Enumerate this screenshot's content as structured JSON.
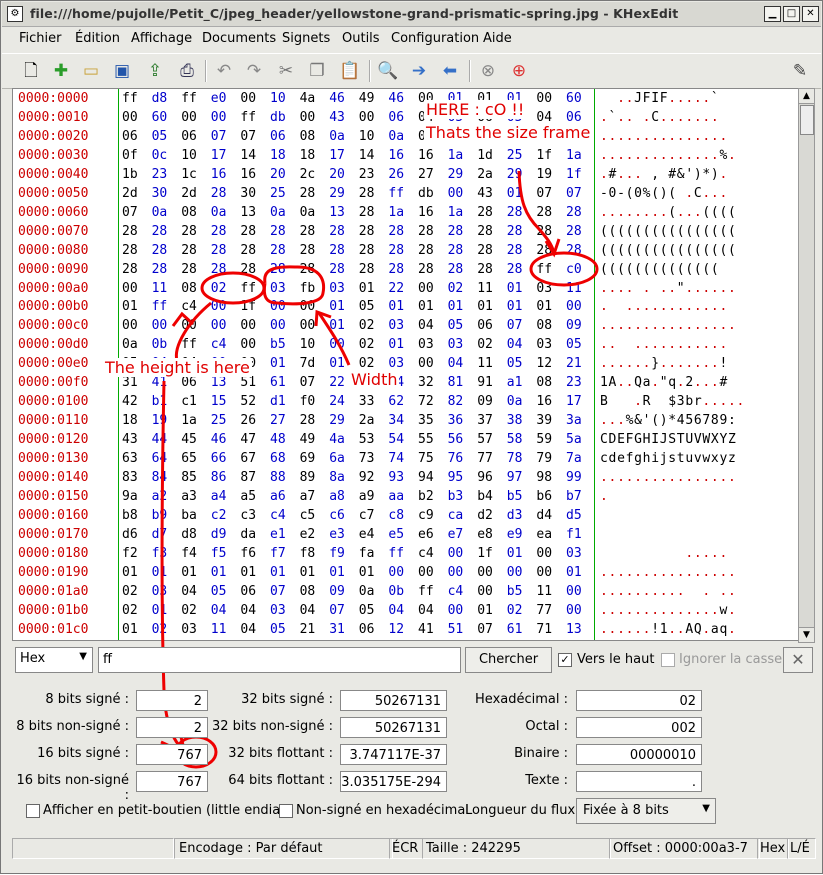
{
  "window": {
    "title": "file:///home/pujolle/Petit_C/jpeg_header/yellowstone-grand-prismatic-spring.jpg - KHexEdit"
  },
  "menu": [
    "Fichier",
    "Édition",
    "Affichage",
    "Documents",
    "Signets",
    "Outils",
    "Configuration",
    "Aide"
  ],
  "toolbar_icons": [
    "new-icon",
    "add-icon",
    "open-folder-icon",
    "save-icon",
    "export-icon",
    "print-icon",
    "undo-icon",
    "redo-icon",
    "copy-cut-icon",
    "copy-icon",
    "paste-icon",
    "find-icon",
    "next-icon",
    "previous-icon",
    "stop-icon",
    "help-icon",
    "edit-icon"
  ],
  "hex_rows": [
    {
      "addr": "0000:0000",
      "bytes": [
        "ff",
        "d8",
        "ff",
        "e0",
        "00",
        "10",
        "4a",
        "46",
        "49",
        "46",
        "00",
        "01",
        "01",
        "01",
        "00",
        "60"
      ],
      "ascii": "  ..JFIF.....`"
    },
    {
      "addr": "0000:0010",
      "bytes": [
        "00",
        "60",
        "00",
        "00",
        "ff",
        "db",
        "00",
        "43",
        "00",
        "06",
        "04",
        "05",
        "06",
        "05",
        "04",
        "06"
      ],
      "ascii": ".`.. .C......."
    },
    {
      "addr": "0000:0020",
      "bytes": [
        "06",
        "05",
        "06",
        "07",
        "07",
        "06",
        "08",
        "0a",
        "10",
        "0a",
        "0a",
        "09",
        "09",
        "0a",
        "14",
        "0e"
      ],
      "ascii": "..............."
    },
    {
      "addr": "0000:0030",
      "bytes": [
        "0f",
        "0c",
        "10",
        "17",
        "14",
        "18",
        "18",
        "17",
        "14",
        "16",
        "16",
        "1a",
        "1d",
        "25",
        "1f",
        "1a"
      ],
      "ascii": "..............%."
    },
    {
      "addr": "0000:0040",
      "bytes": [
        "1b",
        "23",
        "1c",
        "16",
        "16",
        "20",
        "2c",
        "20",
        "23",
        "26",
        "27",
        "29",
        "2a",
        "29",
        "19",
        "1f"
      ],
      "ascii": ".#... , #&')*)."
    },
    {
      "addr": "0000:0050",
      "bytes": [
        "2d",
        "30",
        "2d",
        "28",
        "30",
        "25",
        "28",
        "29",
        "28",
        "ff",
        "db",
        "00",
        "43",
        "01",
        "07",
        "07"
      ],
      "ascii": "-0-(0%()( .C..."
    },
    {
      "addr": "0000:0060",
      "bytes": [
        "07",
        "0a",
        "08",
        "0a",
        "13",
        "0a",
        "0a",
        "13",
        "28",
        "1a",
        "16",
        "1a",
        "28",
        "28",
        "28",
        "28"
      ],
      "ascii": "........(...(((("
    },
    {
      "addr": "0000:0070",
      "bytes": [
        "28",
        "28",
        "28",
        "28",
        "28",
        "28",
        "28",
        "28",
        "28",
        "28",
        "28",
        "28",
        "28",
        "28",
        "28",
        "28"
      ],
      "ascii": "(((((((((((((((("
    },
    {
      "addr": "0000:0080",
      "bytes": [
        "28",
        "28",
        "28",
        "28",
        "28",
        "28",
        "28",
        "28",
        "28",
        "28",
        "28",
        "28",
        "28",
        "28",
        "28",
        "28"
      ],
      "ascii": "(((((((((((((((("
    },
    {
      "addr": "0000:0090",
      "bytes": [
        "28",
        "28",
        "28",
        "28",
        "28",
        "28",
        "28",
        "28",
        "28",
        "28",
        "28",
        "28",
        "28",
        "28",
        "ff",
        "c0"
      ],
      "ascii": "((((((((((((((  "
    },
    {
      "addr": "0000:00a0",
      "bytes": [
        "00",
        "11",
        "08",
        "02",
        "ff",
        "03",
        "fb",
        "03",
        "01",
        "22",
        "00",
        "02",
        "11",
        "01",
        "03",
        "11"
      ],
      "ascii": ".... . ..\"......"
    },
    {
      "addr": "0000:00b0",
      "bytes": [
        "01",
        "ff",
        "c4",
        "00",
        "1f",
        "00",
        "00",
        "01",
        "05",
        "01",
        "01",
        "01",
        "01",
        "01",
        "01",
        "00"
      ],
      "ascii": ".  ............"
    },
    {
      "addr": "0000:00c0",
      "bytes": [
        "00",
        "00",
        "00",
        "00",
        "00",
        "00",
        "00",
        "01",
        "02",
        "03",
        "04",
        "05",
        "06",
        "07",
        "08",
        "09"
      ],
      "ascii": "................"
    },
    {
      "addr": "0000:00d0",
      "bytes": [
        "0a",
        "0b",
        "ff",
        "c4",
        "00",
        "b5",
        "10",
        "00",
        "02",
        "01",
        "03",
        "03",
        "02",
        "04",
        "03",
        "05"
      ],
      "ascii": "..  ..........."
    },
    {
      "addr": "0000:00e0",
      "bytes": [
        "05",
        "04",
        "04",
        "00",
        "00",
        "01",
        "7d",
        "01",
        "02",
        "03",
        "00",
        "04",
        "11",
        "05",
        "12",
        "21"
      ],
      "ascii": "......}.......!"
    },
    {
      "addr": "0000:00f0",
      "bytes": [
        "31",
        "41",
        "06",
        "13",
        "51",
        "61",
        "07",
        "22",
        "71",
        "14",
        "32",
        "81",
        "91",
        "a1",
        "08",
        "23"
      ],
      "ascii": "1A..Qa.\"q.2...#"
    },
    {
      "addr": "0000:0100",
      "bytes": [
        "42",
        "b1",
        "c1",
        "15",
        "52",
        "d1",
        "f0",
        "24",
        "33",
        "62",
        "72",
        "82",
        "09",
        "0a",
        "16",
        "17"
      ],
      "ascii": "B   .R  $3br....."
    },
    {
      "addr": "0000:0110",
      "bytes": [
        "18",
        "19",
        "1a",
        "25",
        "26",
        "27",
        "28",
        "29",
        "2a",
        "34",
        "35",
        "36",
        "37",
        "38",
        "39",
        "3a"
      ],
      "ascii": "...%&'()*456789:"
    },
    {
      "addr": "0000:0120",
      "bytes": [
        "43",
        "44",
        "45",
        "46",
        "47",
        "48",
        "49",
        "4a",
        "53",
        "54",
        "55",
        "56",
        "57",
        "58",
        "59",
        "5a"
      ],
      "ascii": "CDEFGHIJSTUVWXYZ"
    },
    {
      "addr": "0000:0130",
      "bytes": [
        "63",
        "64",
        "65",
        "66",
        "67",
        "68",
        "69",
        "6a",
        "73",
        "74",
        "75",
        "76",
        "77",
        "78",
        "79",
        "7a"
      ],
      "ascii": "cdefghijstuvwxyz"
    },
    {
      "addr": "0000:0140",
      "bytes": [
        "83",
        "84",
        "85",
        "86",
        "87",
        "88",
        "89",
        "8a",
        "92",
        "93",
        "94",
        "95",
        "96",
        "97",
        "98",
        "99"
      ],
      "ascii": "................"
    },
    {
      "addr": "0000:0150",
      "bytes": [
        "9a",
        "a2",
        "a3",
        "a4",
        "a5",
        "a6",
        "a7",
        "a8",
        "a9",
        "aa",
        "b2",
        "b3",
        "b4",
        "b5",
        "b6",
        "b7"
      ],
      "ascii": "."
    },
    {
      "addr": "0000:0160",
      "bytes": [
        "b8",
        "b9",
        "ba",
        "c2",
        "c3",
        "c4",
        "c5",
        "c6",
        "c7",
        "c8",
        "c9",
        "ca",
        "d2",
        "d3",
        "d4",
        "d5"
      ],
      "ascii": ""
    },
    {
      "addr": "0000:0170",
      "bytes": [
        "d6",
        "d7",
        "d8",
        "d9",
        "da",
        "e1",
        "e2",
        "e3",
        "e4",
        "e5",
        "e6",
        "e7",
        "e8",
        "e9",
        "ea",
        "f1"
      ],
      "ascii": ""
    },
    {
      "addr": "0000:0180",
      "bytes": [
        "f2",
        "f3",
        "f4",
        "f5",
        "f6",
        "f7",
        "f8",
        "f9",
        "fa",
        "ff",
        "c4",
        "00",
        "1f",
        "01",
        "00",
        "03"
      ],
      "ascii": "          ....."
    },
    {
      "addr": "0000:0190",
      "bytes": [
        "01",
        "01",
        "01",
        "01",
        "01",
        "01",
        "01",
        "01",
        "01",
        "00",
        "00",
        "00",
        "00",
        "00",
        "00",
        "01"
      ],
      "ascii": "................"
    },
    {
      "addr": "0000:01a0",
      "bytes": [
        "02",
        "03",
        "04",
        "05",
        "06",
        "07",
        "08",
        "09",
        "0a",
        "0b",
        "ff",
        "c4",
        "00",
        "b5",
        "11",
        "00"
      ],
      "ascii": "..........  . .."
    },
    {
      "addr": "0000:01b0",
      "bytes": [
        "02",
        "01",
        "02",
        "04",
        "04",
        "03",
        "04",
        "07",
        "05",
        "04",
        "04",
        "00",
        "01",
        "02",
        "77",
        "00"
      ],
      "ascii": "..............w."
    },
    {
      "addr": "0000:01c0",
      "bytes": [
        "01",
        "02",
        "03",
        "11",
        "04",
        "05",
        "21",
        "31",
        "06",
        "12",
        "41",
        "51",
        "07",
        "61",
        "71",
        "13"
      ],
      "ascii": "......!1..AQ.aq."
    }
  ],
  "annotations": {
    "here": "HERE : cO !!",
    "size_frame": "Thats the size frame",
    "height": "The height is here",
    "width": "Width"
  },
  "find": {
    "type_value": "Hex",
    "search_value": "ff",
    "search_button": "Chercher",
    "upward_label": "Vers le haut",
    "ignore_case_label": "Ignorer la casse",
    "close_glyph": "✕"
  },
  "conversion": {
    "s8_label": "8 bits signé :",
    "s8": "2",
    "u8_label": "8 bits non-signé :",
    "u8": "2",
    "s16_label": "16 bits signé :",
    "s16": "767",
    "u16_label": "16 bits non-signé :",
    "u16": "767",
    "s32_label": "32 bits signé :",
    "s32": "50267131",
    "u32_label": "32 bits non-signé :",
    "u32": "50267131",
    "f32_label": "32 bits flottant :",
    "f32": "3.747117E-37",
    "f64_label": "64 bits flottant :",
    "f64": "3.035175E-294",
    "hex_label": "Hexadécimal :",
    "hex": "02",
    "oct_label": "Octal :",
    "oct": "002",
    "bin_label": "Binaire :",
    "bin": "00000010",
    "text_label": "Texte :",
    "text": ".",
    "little_endian_label": "Afficher en petit-boutien (little endian)",
    "unsigned_hex_label": "Non-signé en hexadécimal",
    "stream_len_label": "Longueur du flux :",
    "stream_len_value": "Fixée à 8 bits"
  },
  "status": {
    "encoding": "Encodage : Par défaut",
    "mode": "ÉCR",
    "size": "Taille : 242295",
    "offset": "Offset : 0000:00a3-7",
    "hex": "Hex",
    "le": "L/É"
  }
}
